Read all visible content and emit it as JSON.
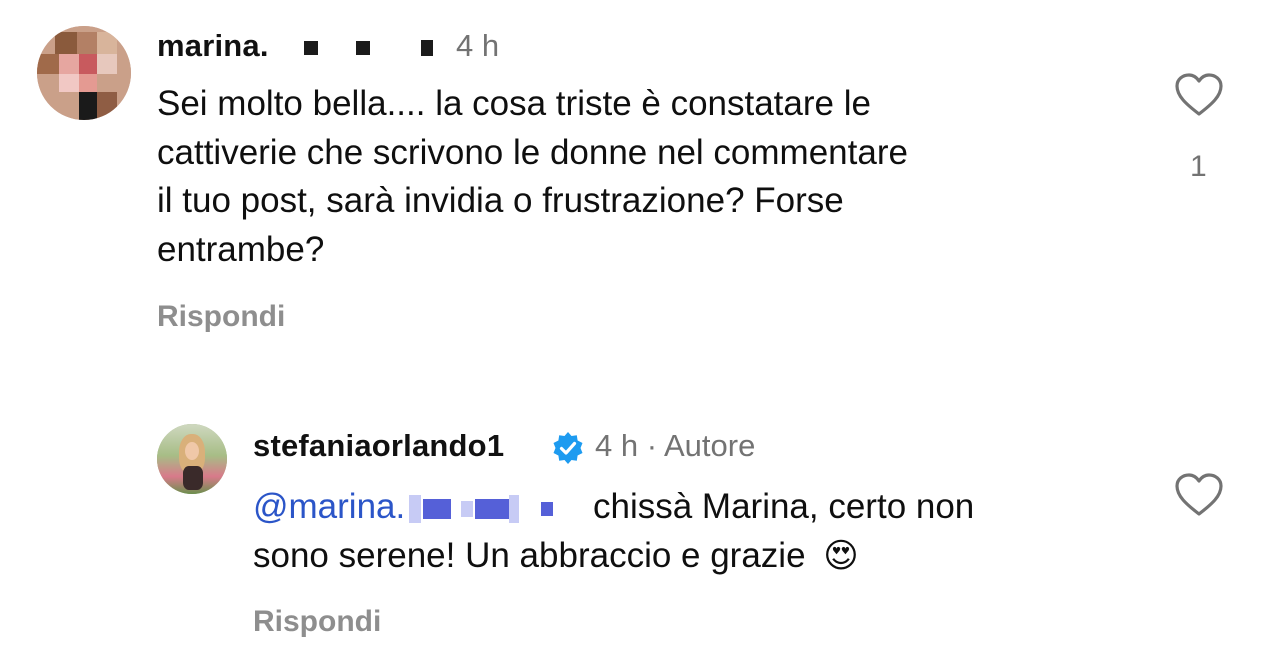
{
  "comment": {
    "username": "marina.",
    "time": "4 h",
    "text_line1": "Sei molto bella.... la cosa triste è constatare  le",
    "text_line2": "cattiverie che scrivono le donne nel commentare",
    "text_line3": "il tuo post, sarà invidia o frustrazione? Forse",
    "text_line4": "entrambe?",
    "reply_label": "Rispondi",
    "like_count": "1",
    "icons": {
      "like": "heart-outline-icon"
    }
  },
  "reply": {
    "username": "stefaniaorlando1",
    "time": "4 h",
    "separator": "·",
    "author_label": "Autore",
    "mention": "@marina.",
    "text_part1": "chissà Marina, certo non",
    "text_line2": "sono serene! Un abbraccio e grazie",
    "emoji": "😍",
    "reply_label": "Rispondi",
    "icons": {
      "verified": "verified-badge-icon",
      "like": "heart-outline-icon"
    }
  },
  "colors": {
    "mention": "#2b55c8",
    "verified": "#1d9bf0",
    "secondary_text": "#737373"
  }
}
